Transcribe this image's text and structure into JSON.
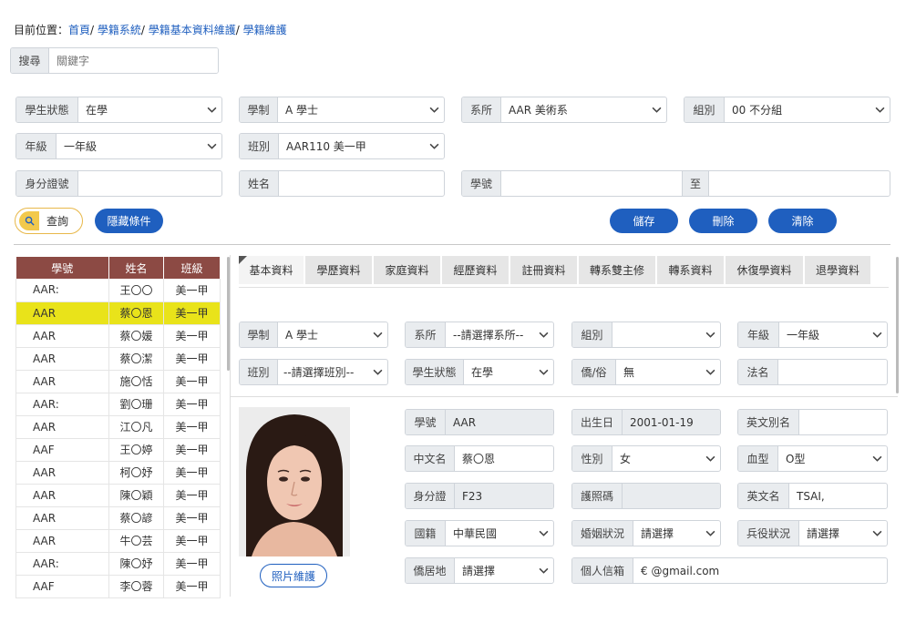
{
  "breadcrumb": {
    "prefix": "目前位置：",
    "items": [
      "首頁",
      "學籍系統",
      "學籍基本資料維護",
      "學籍維護"
    ],
    "sep": "/ "
  },
  "search": {
    "label": "搜尋",
    "placeholder": "關鍵字"
  },
  "filters": {
    "status": {
      "label": "學生狀態",
      "value": "在學"
    },
    "system": {
      "label": "學制",
      "value": "A 學士"
    },
    "dept": {
      "label": "系所",
      "value": "AAR 美術系"
    },
    "group": {
      "label": "組別",
      "value": "00 不分組"
    },
    "grade": {
      "label": "年級",
      "value": "一年級"
    },
    "class": {
      "label": "班別",
      "value": "AAR110 美一甲"
    },
    "id_no": {
      "label": "身分證號",
      "value": ""
    },
    "name": {
      "label": "姓名",
      "value": ""
    },
    "stu_no": {
      "label": "學號",
      "value": ""
    },
    "stu_no_to": {
      "label": "至",
      "value": ""
    }
  },
  "buttons": {
    "query": "查詢",
    "hide_conditions": "隱藏條件",
    "save": "儲存",
    "delete": "刪除",
    "clear": "清除",
    "photo_maint": "照片維護"
  },
  "student_list": {
    "headers": [
      "學號",
      "姓名",
      "班級"
    ],
    "rows": [
      {
        "no": "AAR:",
        "name": "王〇〇",
        "cls": "美一甲"
      },
      {
        "no": "AAR",
        "name": "蔡〇恩",
        "cls": "美一甲"
      },
      {
        "no": "AAR",
        "name": "蔡〇媛",
        "cls": "美一甲"
      },
      {
        "no": "AAR",
        "name": "蔡〇潔",
        "cls": "美一甲"
      },
      {
        "no": "AAR",
        "name": "施〇恬",
        "cls": "美一甲"
      },
      {
        "no": "AAR:",
        "name": "劉〇珊",
        "cls": "美一甲"
      },
      {
        "no": "AAR",
        "name": "江〇凡",
        "cls": "美一甲"
      },
      {
        "no": "AAF",
        "name": "王〇婷",
        "cls": "美一甲"
      },
      {
        "no": "AAR",
        "name": "柯〇妤",
        "cls": "美一甲"
      },
      {
        "no": "AAR",
        "name": "陳〇穎",
        "cls": "美一甲"
      },
      {
        "no": "AAR",
        "name": "蔡〇諺",
        "cls": "美一甲"
      },
      {
        "no": "AAR",
        "name": "牛〇芸",
        "cls": "美一甲"
      },
      {
        "no": "AAR:",
        "name": "陳〇妤",
        "cls": "美一甲"
      },
      {
        "no": "AAF",
        "name": "李〇蓉",
        "cls": "美一甲"
      }
    ],
    "selected_index": 1
  },
  "tabs": [
    "基本資料",
    "學歷資料",
    "家庭資料",
    "經歷資料",
    "註冊資料",
    "轉系雙主修",
    "轉系資料",
    "休復學資料",
    "退學資料"
  ],
  "detail_top": {
    "system": {
      "label": "學制",
      "value": "A 學士"
    },
    "dept": {
      "label": "系所",
      "value": "--請選擇系所--"
    },
    "group": {
      "label": "組別",
      "value": ""
    },
    "grade": {
      "label": "年級",
      "value": "一年級"
    },
    "class": {
      "label": "班別",
      "value": "--請選擇班別--"
    },
    "status": {
      "label": "學生狀態",
      "value": "在學"
    },
    "ethnic": {
      "label": "僑/俗",
      "value": "無"
    },
    "dharma": {
      "label": "法名",
      "value": ""
    }
  },
  "basic": {
    "stu_no": {
      "label": "學號",
      "value": "AAR"
    },
    "birth": {
      "label": "出生日",
      "value": "2001-01-19"
    },
    "eng_alias": {
      "label": "英文別名",
      "value": ""
    },
    "cname": {
      "label": "中文名",
      "value": "蔡〇恩"
    },
    "gender": {
      "label": "性別",
      "value": "女"
    },
    "blood": {
      "label": "血型",
      "value": "O型"
    },
    "id_no": {
      "label": "身分證",
      "value": "F23"
    },
    "passport": {
      "label": "護照碼",
      "value": ""
    },
    "ename": {
      "label": "英文名",
      "value": "TSAI,"
    },
    "nation": {
      "label": "國籍",
      "value": "中華民國"
    },
    "marital": {
      "label": "婚姻狀況",
      "value": "請選擇"
    },
    "military": {
      "label": "兵役狀況",
      "value": "請選擇"
    },
    "overseas": {
      "label": "僑居地",
      "value": "請選擇"
    },
    "email": {
      "label": "個人信箱",
      "value": "€            @gmail.com"
    }
  },
  "colors": {
    "primary": "#1f5fbf",
    "table_header": "#8c4a44",
    "selected_row": "#e9e31a",
    "query_accent": "#f2c94c"
  }
}
